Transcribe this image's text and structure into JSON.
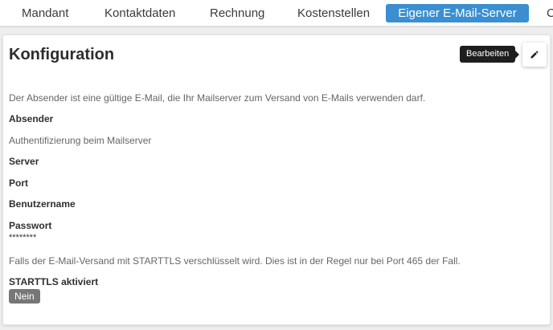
{
  "tabs": [
    {
      "label": "Mandant"
    },
    {
      "label": "Kontaktdaten"
    },
    {
      "label": "Rechnung"
    },
    {
      "label": "Kostenstellen"
    },
    {
      "label": "Eigener E-Mail-Server",
      "active": true
    },
    {
      "label": "C"
    }
  ],
  "card": {
    "title": "Konfiguration",
    "edit_tooltip": "Bearbeiten",
    "edit_icon": "pencil-icon"
  },
  "fields": {
    "sender_hint": "Der Absender ist eine gültige E-Mail, die Ihr Mailserver zum Versand von E-Mails verwenden darf.",
    "sender_label": "Absender",
    "auth_hint": "Authentifizierung beim Mailserver",
    "server_label": "Server",
    "port_label": "Port",
    "username_label": "Benutzername",
    "password_label": "Passwort",
    "password_value": "********",
    "starttls_hint": "Falls der E-Mail-Versand mit STARTTLS verschlüsselt wird. Dies ist in der Regel nur bei Port 465 der Fall.",
    "starttls_label": "STARTTLS aktiviert",
    "starttls_value": "Nein"
  },
  "colors": {
    "accent": "#3b8fd0",
    "badge": "#777777",
    "tooltip": "#1e1e1e"
  }
}
